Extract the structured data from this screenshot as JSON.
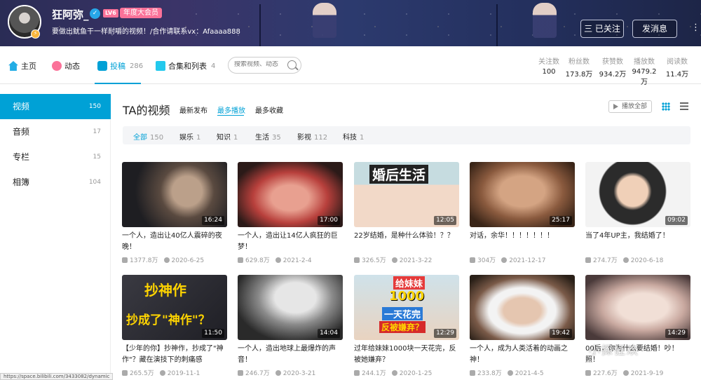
{
  "user": {
    "name": "狂阿弥_",
    "level": "LV6",
    "vip": "年度大会员",
    "sign": "要做出鱿鱼干一样耐嚼的视频！/合作请联系vx：Afaaaa888"
  },
  "header_buttons": {
    "followed": "三 已关注",
    "message": "发消息"
  },
  "nav": {
    "home": "主页",
    "dynamic": "动态",
    "posts": "投稿",
    "posts_count": "286",
    "collections": "合集和列表",
    "collections_count": "4",
    "search_placeholder": "搜索视频、动态"
  },
  "stats": [
    {
      "label": "关注数",
      "value": "100"
    },
    {
      "label": "粉丝数",
      "value": "173.8万"
    },
    {
      "label": "获赞数",
      "value": "934.2万"
    },
    {
      "label": "播放数",
      "value": "9479.2万"
    },
    {
      "label": "阅读数",
      "value": "11.4万"
    }
  ],
  "sidebar": [
    {
      "label": "视频",
      "count": "150"
    },
    {
      "label": "音频",
      "count": "17"
    },
    {
      "label": "专栏",
      "count": "15"
    },
    {
      "label": "相簿",
      "count": "104"
    }
  ],
  "main": {
    "title": "TA的视频",
    "sort_tabs": [
      "最新发布",
      "最多播放",
      "最多收藏"
    ],
    "play_all": "播放全部"
  },
  "filters": [
    {
      "label": "全部",
      "count": "150"
    },
    {
      "label": "娱乐",
      "count": "1"
    },
    {
      "label": "知识",
      "count": "1"
    },
    {
      "label": "生活",
      "count": "35"
    },
    {
      "label": "影视",
      "count": "112"
    },
    {
      "label": "科技",
      "count": "1"
    }
  ],
  "videos": [
    {
      "title": "一个人，造出让40亿人震碎的夜晚！",
      "views": "1377.8万",
      "date": "2020-6-25",
      "duration": "16:24"
    },
    {
      "title": "一个人，造出让14亿人疯狂的巨梦！",
      "views": "629.8万",
      "date": "2021-2-4",
      "duration": "17:00"
    },
    {
      "title": "22岁结婚，是种什么体验！？？",
      "views": "326.5万",
      "date": "2021-3-22",
      "duration": "12:05",
      "thumb_text": "婚后生活"
    },
    {
      "title": "对话，余华！！！！！！！",
      "views": "304万",
      "date": "2021-12-17",
      "duration": "25:17"
    },
    {
      "title": "当了4年UP主，我结婚了！",
      "views": "274.7万",
      "date": "2020-6-18",
      "duration": "09:02"
    },
    {
      "title": "【少年的你】抄神作，抄成了\"神作\"？藏在演技下的刺痛感",
      "views": "265.5万",
      "date": "2019-11-1",
      "duration": "11:50",
      "thumb_text": "抄神作",
      "thumb_text2": "抄成了\"神作\"？"
    },
    {
      "title": "一个人，造出地球上最爆炸的声音！",
      "views": "246.7万",
      "date": "2020-3-21",
      "duration": "14:04"
    },
    {
      "title": "过年给妹妹1000块一天花完，反被她嫌弃？",
      "views": "244.1万",
      "date": "2020-1-25",
      "duration": "12:29",
      "thumb_text": "给妹妹",
      "thumb_text2": "1000",
      "thumb_text3": "一天花完",
      "thumb_text4": "反被嫌弃？"
    },
    {
      "title": "一个人，成为人类活着的动画之神！",
      "views": "233.8万",
      "date": "2021-4-5",
      "duration": "19:42"
    },
    {
      "title": "00后，你为什么要结婚！吵！照！",
      "views": "227.6万",
      "date": "2021-9-19",
      "duration": "14:29"
    }
  ],
  "watermark": "小探狂欢",
  "status_url": "https://space.bilibili.com/3433082/dynamic"
}
